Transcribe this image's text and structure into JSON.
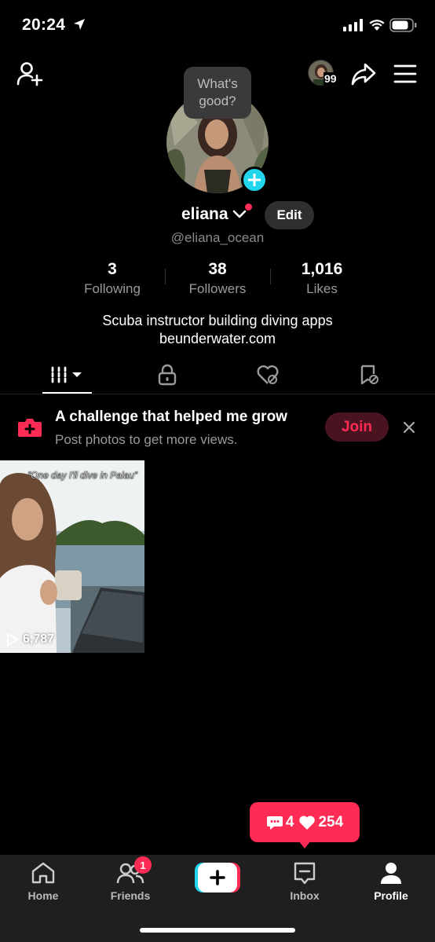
{
  "status_bar": {
    "time": "20:24"
  },
  "header": {
    "visitor_count": "99"
  },
  "profile": {
    "bubble_text": "What's good?",
    "username": "eliana",
    "handle": "@eliana_ocean",
    "edit_label": "Edit",
    "bio_line1": "Scuba instructor building diving apps",
    "bio_line2": "beunderwater.com"
  },
  "stats": [
    {
      "value": "3",
      "label": "Following"
    },
    {
      "value": "38",
      "label": "Followers"
    },
    {
      "value": "1,016",
      "label": "Likes"
    }
  ],
  "tabs": [
    {
      "icon": "grid-videos-icon",
      "active": true
    },
    {
      "icon": "lock-icon",
      "active": false
    },
    {
      "icon": "liked-hidden-icon",
      "active": false
    },
    {
      "icon": "favorites-hidden-icon",
      "active": false
    }
  ],
  "challenge": {
    "title": "A challenge that helped me grow",
    "subtitle": "Post photos to get more views.",
    "join_label": "Join"
  },
  "videos": [
    {
      "caption": "“One day I'll dive in Palau”",
      "views": "6,787"
    }
  ],
  "notification": {
    "comments": "4",
    "likes": "254"
  },
  "nav": {
    "home": "Home",
    "friends": "Friends",
    "friends_badge": "1",
    "inbox": "Inbox",
    "profile": "Profile"
  },
  "colors": {
    "accent": "#fe2c55",
    "cyan": "#20d5ec",
    "background": "#000000"
  }
}
